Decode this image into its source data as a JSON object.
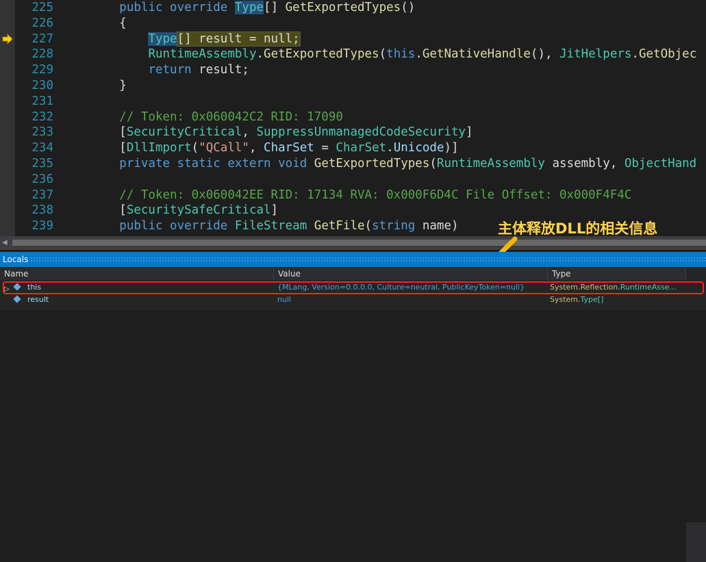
{
  "editor": {
    "lines": [
      {
        "n": "225",
        "t": [
          {
            "c": "pl",
            "v": "        "
          },
          {
            "c": "kw",
            "v": "public override "
          },
          {
            "c": "ty hl-type",
            "v": "Type"
          },
          {
            "c": "pl",
            "v": "[] "
          },
          {
            "c": "fn",
            "v": "GetExportedTypes"
          },
          {
            "c": "pl",
            "v": "()"
          }
        ]
      },
      {
        "n": "226",
        "t": [
          {
            "c": "pl",
            "v": "        {"
          }
        ]
      },
      {
        "n": "227",
        "cur": true,
        "t": [
          {
            "c": "pl",
            "v": "            "
          },
          {
            "c": "ty hl-type",
            "v": "Type"
          },
          {
            "c": "pl cur-line",
            "v": "[] result = null;"
          }
        ]
      },
      {
        "n": "228",
        "t": [
          {
            "c": "pl",
            "v": "            "
          },
          {
            "c": "ty",
            "v": "RuntimeAssembly"
          },
          {
            "c": "pl",
            "v": "."
          },
          {
            "c": "fn",
            "v": "GetExportedTypes"
          },
          {
            "c": "pl",
            "v": "("
          },
          {
            "c": "kw",
            "v": "this"
          },
          {
            "c": "pl",
            "v": "."
          },
          {
            "c": "fn",
            "v": "GetNativeHandle"
          },
          {
            "c": "pl",
            "v": "(), "
          },
          {
            "c": "ty",
            "v": "JitHelpers"
          },
          {
            "c": "pl",
            "v": "."
          },
          {
            "c": "fn",
            "v": "GetObjec"
          }
        ]
      },
      {
        "n": "229",
        "t": [
          {
            "c": "pl",
            "v": "            "
          },
          {
            "c": "kw",
            "v": "return"
          },
          {
            "c": "pl",
            "v": " result;"
          }
        ]
      },
      {
        "n": "230",
        "t": [
          {
            "c": "pl",
            "v": "        }"
          }
        ]
      },
      {
        "n": "231",
        "t": []
      },
      {
        "n": "232",
        "t": [
          {
            "c": "pl",
            "v": "        "
          },
          {
            "c": "cm",
            "v": "// Token: 0x060042C2 RID: 17090"
          }
        ]
      },
      {
        "n": "233",
        "t": [
          {
            "c": "pl",
            "v": "        ["
          },
          {
            "c": "ty",
            "v": "SecurityCritical"
          },
          {
            "c": "pl",
            "v": ", "
          },
          {
            "c": "ty",
            "v": "SuppressUnmanagedCodeSecurity"
          },
          {
            "c": "pl",
            "v": "]"
          }
        ]
      },
      {
        "n": "234",
        "t": [
          {
            "c": "pl",
            "v": "        ["
          },
          {
            "c": "ty",
            "v": "DllImport"
          },
          {
            "c": "pl",
            "v": "("
          },
          {
            "c": "st",
            "v": "\"QCall\""
          },
          {
            "c": "pl",
            "v": ", "
          },
          {
            "c": "pm",
            "v": "CharSet"
          },
          {
            "c": "pl",
            "v": " = "
          },
          {
            "c": "ty",
            "v": "CharSet"
          },
          {
            "c": "pl",
            "v": "."
          },
          {
            "c": "pm",
            "v": "Unicode"
          },
          {
            "c": "pl",
            "v": ")]"
          }
        ]
      },
      {
        "n": "235",
        "t": [
          {
            "c": "pl",
            "v": "        "
          },
          {
            "c": "kw",
            "v": "private static extern void "
          },
          {
            "c": "fn",
            "v": "GetExportedTypes"
          },
          {
            "c": "pl",
            "v": "("
          },
          {
            "c": "ty",
            "v": "RuntimeAssembly"
          },
          {
            "c": "pl",
            "v": " assembly, "
          },
          {
            "c": "ty",
            "v": "ObjectHand"
          }
        ]
      },
      {
        "n": "236",
        "t": []
      },
      {
        "n": "237",
        "t": [
          {
            "c": "pl",
            "v": "        "
          },
          {
            "c": "cm",
            "v": "// Token: 0x060042EE RID: 17134 RVA: 0x000F6D4C File Offset: 0x000F4F4C"
          }
        ]
      },
      {
        "n": "238",
        "t": [
          {
            "c": "pl",
            "v": "        ["
          },
          {
            "c": "ty",
            "v": "SecuritySafeCritical"
          },
          {
            "c": "pl",
            "v": "]"
          }
        ]
      },
      {
        "n": "239",
        "t": [
          {
            "c": "pl",
            "v": "        "
          },
          {
            "c": "kw",
            "v": "public override "
          },
          {
            "c": "ty",
            "v": "FileStream"
          },
          {
            "c": "pl",
            "v": " "
          },
          {
            "c": "fn",
            "v": "GetFile"
          },
          {
            "c": "pl",
            "v": "("
          },
          {
            "c": "kw",
            "v": "string"
          },
          {
            "c": "pl",
            "v": " name)"
          }
        ]
      }
    ]
  },
  "annotation": "主体释放DLL的相关信息",
  "locals": {
    "title": "Locals",
    "columns": {
      "name": "Name",
      "value": "Value",
      "type": "Type"
    },
    "rows": [
      {
        "name": "this",
        "value": "{MLang, Version=0.0.0.0, Culture=neutral, PublicKeyToken=null}",
        "type_prefix": "System.Reflection.",
        "type_main": "RuntimeAsse..."
      },
      {
        "name": "result",
        "value": "null",
        "type_prefix": "System.",
        "type_main": "Type[]"
      }
    ]
  }
}
